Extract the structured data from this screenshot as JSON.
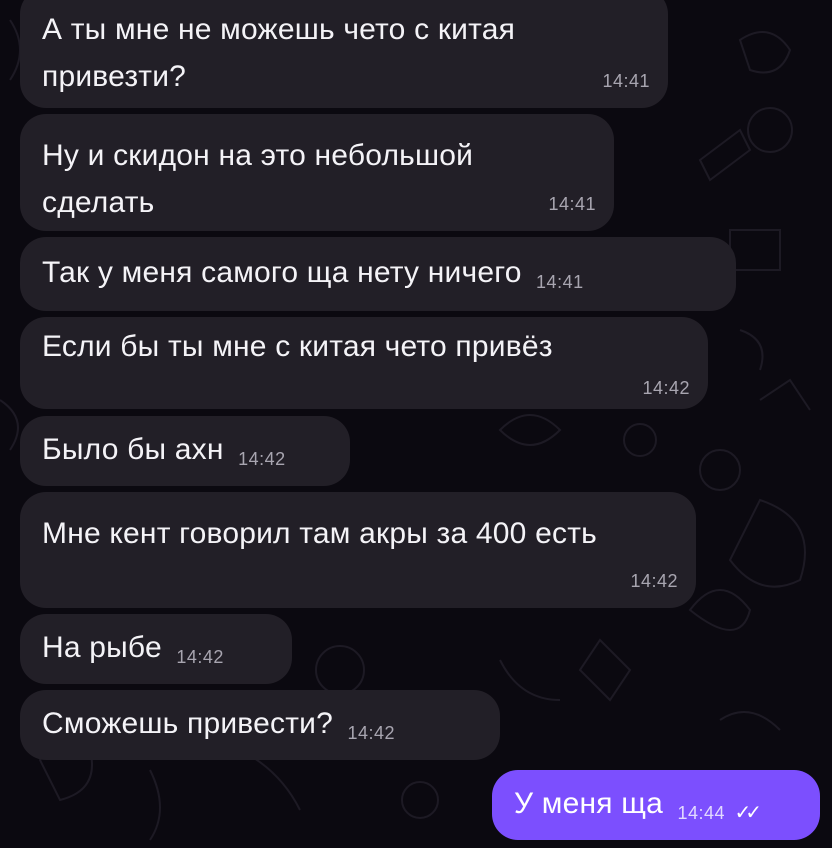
{
  "chat": {
    "messages": [
      {
        "text": "А ты мне не можешь чето с китая привезти?",
        "time": "14:41"
      },
      {
        "text": "Ну и скидон на это небольшой сделать",
        "time": "14:41"
      },
      {
        "text": "Так у меня самого ща нету ничего",
        "time": "14:41"
      },
      {
        "text": "Если бы ты мне с китая чето привёз",
        "time": "14:42"
      },
      {
        "text": "Было бы ахн",
        "time": "14:42"
      },
      {
        "text": "Мне кент говорил там акры за 400 есть",
        "time": "14:42"
      },
      {
        "text": "На рыбе",
        "time": "14:42"
      },
      {
        "text": "Сможешь привести?",
        "time": "14:42"
      }
    ],
    "outgoing": {
      "text": "У меня ща",
      "time": "14:44",
      "status_icon": "double-check-icon"
    }
  },
  "colors": {
    "background": "#0b0910",
    "incoming_bubble": "#221f27",
    "outgoing_bubble": "#7c4ffe"
  }
}
